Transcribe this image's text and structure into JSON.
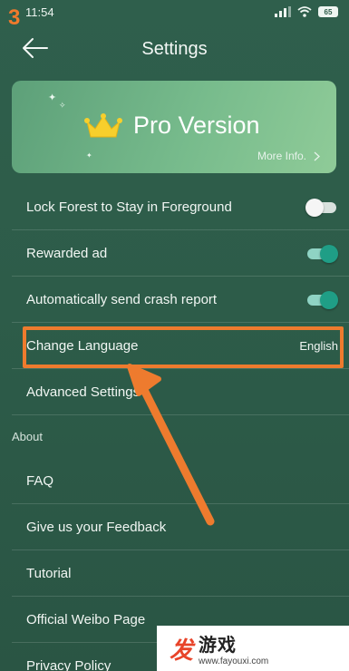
{
  "step_marker": "3",
  "status": {
    "time": "11:54",
    "battery": "65"
  },
  "appbar": {
    "title": "Settings"
  },
  "pro_card": {
    "title": "Pro Version",
    "more_info": "More Info."
  },
  "settings": [
    {
      "label": "Lock Forest to Stay in Foreground",
      "toggle": "off"
    },
    {
      "label": "Rewarded ad",
      "toggle": "on"
    },
    {
      "label": "Automatically send crash report",
      "toggle": "on"
    },
    {
      "label": "Change Language",
      "value": "English"
    },
    {
      "label": "Advanced Settings"
    }
  ],
  "about": {
    "header": "About",
    "items": [
      {
        "label": "FAQ"
      },
      {
        "label": "Give us your Feedback"
      },
      {
        "label": "Tutorial"
      },
      {
        "label": "Official Weibo Page"
      },
      {
        "label": "Privacy Policy"
      }
    ]
  },
  "watermark": {
    "logo": "发",
    "name": "游戏",
    "url": "www.fayouxi.com"
  },
  "colors": {
    "background": "#2d5c49",
    "accent": "#1f9e86",
    "highlight": "#ee7b2e"
  }
}
